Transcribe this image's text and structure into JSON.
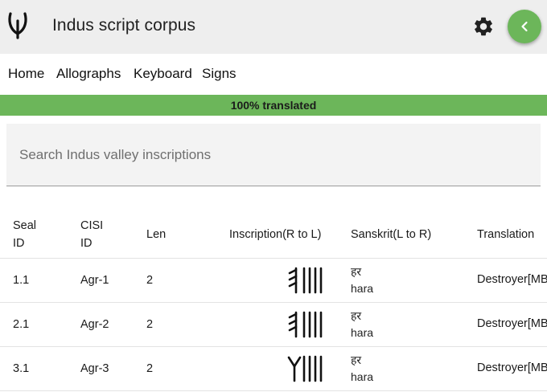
{
  "app": {
    "title": "Indus script corpus",
    "logo_icon": "indus-logo-icon",
    "settings_icon": "gear-icon",
    "back_icon": "chevron-left-icon",
    "accent": "#6cb65a"
  },
  "nav": {
    "items": [
      "Home",
      "Allographs",
      "Keyboard",
      "Signs"
    ]
  },
  "progress": {
    "label": "100% translated",
    "value": 1.0
  },
  "search": {
    "placeholder": "Search Indus valley inscriptions"
  },
  "table": {
    "headers": {
      "seal_id_line1": "Seal",
      "seal_id_line2": "ID",
      "cisi_id_line1": "CISI",
      "cisi_id_line2": "ID",
      "len": "Len",
      "inscription": "Inscription(R to L)",
      "sanskrit": "Sanskrit(L to R)",
      "translation": "Translation"
    },
    "rows": [
      {
        "seal_id": "1.1",
        "cisi_id": "Agr-1",
        "len": "2",
        "inscription_glyph": "pronged-four-strokes",
        "sanskrit_deva": "हर",
        "sanskrit_latin": "hara",
        "translation": "Destroyer[MB"
      },
      {
        "seal_id": "2.1",
        "cisi_id": "Agr-2",
        "len": "2",
        "inscription_glyph": "pronged-four-strokes",
        "sanskrit_deva": "हर",
        "sanskrit_latin": "hara",
        "translation": "Destroyer[MB"
      },
      {
        "seal_id": "3.1",
        "cisi_id": "Agr-3",
        "len": "2",
        "inscription_glyph": "forked-four-strokes",
        "sanskrit_deva": "हर",
        "sanskrit_latin": "hara",
        "translation": "Destroyer[MB"
      }
    ]
  }
}
